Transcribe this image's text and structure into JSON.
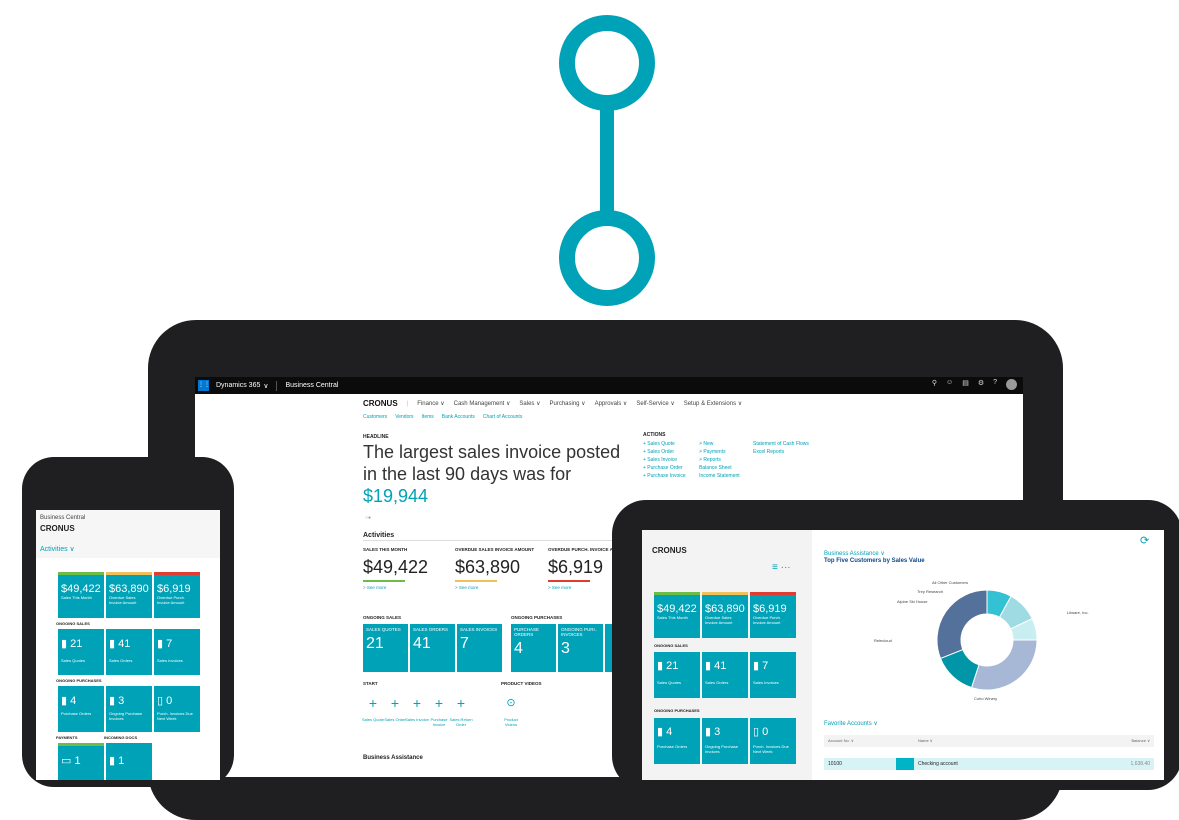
{
  "desktop": {
    "topbar": {
      "app": "Dynamics 365",
      "chev": "∨",
      "product": "Business Central"
    },
    "company": "CRONUS",
    "nav": [
      "Finance ∨",
      "Cash Management ∨",
      "Sales ∨",
      "Purchasing ∨",
      "Approvals ∨",
      "Self-Service ∨",
      "Setup & Extensions ∨"
    ],
    "subnav": [
      "Customers",
      "Vendors",
      "Items",
      "Bank Accounts",
      "Chart of Accounts"
    ],
    "headline_label": "HEADLINE",
    "headline_text": "The largest sales invoice posted in the last 90 days was for",
    "headline_amount": "$19,944",
    "activities": "Activities",
    "kpis": [
      {
        "label": "SALES THIS MONTH",
        "value": "$49,422",
        "more": "> See more",
        "color": "#6bbd46"
      },
      {
        "label": "OVERDUE SALES INVOICE AMOUNT",
        "value": "$63,890",
        "more": "> See more",
        "color": "#f0c05a"
      },
      {
        "label": "OVERDUE PURCH. INVOICE AM",
        "value": "$6,919",
        "more": "> See more",
        "color": "#e03c31"
      }
    ],
    "ongoing_sales": "ONGOING SALES",
    "ongoing_purchases": "ONGOING PURCHASES",
    "sales_tiles": [
      {
        "label": "SALES QUOTES",
        "n": "21"
      },
      {
        "label": "SALES ORDERS",
        "n": "41"
      },
      {
        "label": "SALES INVOICES",
        "n": "7"
      }
    ],
    "purch_tiles": [
      {
        "label": "PURCHASE ORDERS",
        "n": "4"
      },
      {
        "label": "ONGOING PURI.. INVOICES",
        "n": "3"
      }
    ],
    "start": "START",
    "product_videos": "PRODUCT VIDEOS",
    "start_items": [
      "Sales Quote",
      "Sales Order",
      "Sales Invoice",
      "Purchase Invoice",
      "Sales Return Order"
    ],
    "video_label": "Product Videos",
    "business_assistance": "Business Assistance",
    "actions": {
      "title": "ACTIONS",
      "col1": [
        "+ Sales Quote",
        "+ Sales Order",
        "+ Sales Invoice",
        "+ Purchase Order",
        "+ Purchase Invoice"
      ],
      "col2": [
        "> New",
        "> Payments",
        "> Reports",
        "Balance Sheet",
        "Income Statement"
      ],
      "col3": [
        "Statement of Cash Flows",
        "Excel Reports"
      ]
    }
  },
  "phone": {
    "product": "Business Central",
    "company": "CRONUS",
    "activities": "Activities ∨",
    "kpis": [
      {
        "v": "$49,422",
        "l": "Sales This Month",
        "c": "#6bbd46"
      },
      {
        "v": "$63,890",
        "l": "Overdue Sales Invoice Amount",
        "c": "#f0c05a"
      },
      {
        "v": "$6,919",
        "l": "Overdue Purch. Invoice Amount",
        "c": "#e03c31"
      }
    ],
    "ongoing_sales": "ONGOING SALES",
    "sales": [
      {
        "n": "21",
        "l": "Sales Quotes"
      },
      {
        "n": "41",
        "l": "Sales Orders"
      },
      {
        "n": "7",
        "l": "Sales Invoices"
      }
    ],
    "ongoing_purchases": "ONGOING PURCHASES",
    "purch": [
      {
        "n": "4",
        "l": "Purchase Orders"
      },
      {
        "n": "3",
        "l": "Ongoing Purchase Invoices"
      },
      {
        "n": "0",
        "l": "Purch. Invoices Due Next Week"
      }
    ],
    "payments": "PAYMENTS",
    "incoming": "INCOMING DOCS",
    "bottom": [
      {
        "n": "1"
      },
      {
        "n": "1"
      }
    ]
  },
  "tablet": {
    "company": "CRONUS",
    "menu": "≡  ···",
    "kpis": [
      {
        "v": "$49,422",
        "l": "Sales This Month",
        "c": "#6bbd46"
      },
      {
        "v": "$63,890",
        "l": "Overdue Sales Invoice Amount",
        "c": "#f0c05a"
      },
      {
        "v": "$6,919",
        "l": "Overdue Purch. Invoice Amount",
        "c": "#e03c31"
      }
    ],
    "ongoing_sales": "ONGOING SALES",
    "sales": [
      {
        "n": "21",
        "l": "Sales Quotes"
      },
      {
        "n": "41",
        "l": "Sales Orders"
      },
      {
        "n": "7",
        "l": "Sales Invoices"
      }
    ],
    "ongoing_purchases": "ONGOING PURCHASES",
    "purch": [
      {
        "n": "4",
        "l": "Purchase Orders"
      },
      {
        "n": "3",
        "l": "Ongoing Purchase Invoices"
      },
      {
        "n": "0",
        "l": "Purch. Invoices Due Next Week"
      }
    ],
    "ba": "Business Assistance ∨",
    "chart_title": "Top Five Customers by Sales Value",
    "favorite": "Favorite Accounts ∨",
    "col_no": "Account No. ∨",
    "col_name": "Name ∨",
    "col_bal": "Balance ∨",
    "row": {
      "no": "10100",
      "name": "Checking account",
      "bal": "1,638.40"
    }
  },
  "chart_data": {
    "type": "pie",
    "title": "Top Five Customers by Sales Value",
    "categories": [
      "Trey Research",
      "Alpine Ski House",
      "All Other Customers",
      "Coho Winery",
      "Relecloud",
      "Litware, Inc."
    ],
    "values": [
      8,
      10,
      7,
      30,
      14,
      31
    ],
    "colors": [
      "#33c2d4",
      "#9edbe3",
      "#c9eef2",
      "#a7b8d6",
      "#0096a8",
      "#54719b"
    ],
    "legend": "labels around"
  }
}
